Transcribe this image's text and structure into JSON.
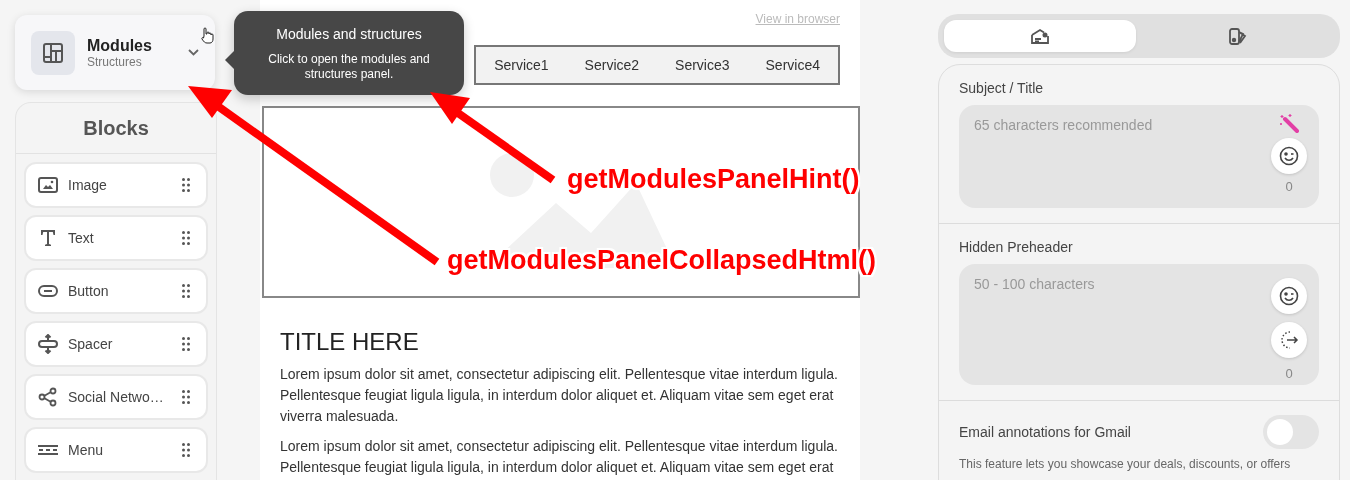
{
  "modules_card": {
    "title": "Modules",
    "subtitle": "Structures"
  },
  "tooltip": {
    "title": "Modules and structures",
    "text": "Click to open the modules and structures panel."
  },
  "blocks_panel": {
    "title": "Blocks",
    "items": [
      {
        "kind": "image",
        "label": "Image"
      },
      {
        "kind": "text",
        "label": "Text"
      },
      {
        "kind": "button",
        "label": "Button"
      },
      {
        "kind": "spacer",
        "label": "Spacer"
      },
      {
        "kind": "social",
        "label": "Social Netwo…"
      },
      {
        "kind": "menu",
        "label": "Menu"
      }
    ]
  },
  "canvas": {
    "view_link": "View in browser",
    "menu": [
      "Service1",
      "Service2",
      "Service3",
      "Service4"
    ],
    "title": "TITLE HERE",
    "paragraphs": [
      "Lorem ipsum dolor sit amet, consectetur adipiscing elit. Pellentesque vitae interdum ligula. Pellentesque feugiat ligula ligula, in interdum dolor aliquet et. Aliquam vitae sem eget erat viverra malesuada.",
      "Lorem ipsum dolor sit amet, consectetur adipiscing elit. Pellentesque vitae interdum ligula. Pellentesque feugiat ligula ligula, in interdum dolor aliquet et. Aliquam vitae sem eget erat"
    ]
  },
  "settings": {
    "tabs": [
      {
        "kind": "envelope",
        "selected": true
      },
      {
        "kind": "palette",
        "selected": false
      }
    ],
    "subject": {
      "label": "Subject / Title",
      "placeholder": "65 characters recommended",
      "count": "0"
    },
    "preheader": {
      "label": "Hidden Preheader",
      "placeholder": "50 - 100 characters",
      "count": "0"
    },
    "gmail": {
      "label": "Email annotations for Gmail",
      "on": false,
      "description": "This feature lets you showcase your deals, discounts, or offers"
    }
  },
  "annotations": [
    {
      "text": "getModulesPanelHint()"
    },
    {
      "text": "getModulesPanelCollapsedHtml()"
    }
  ]
}
